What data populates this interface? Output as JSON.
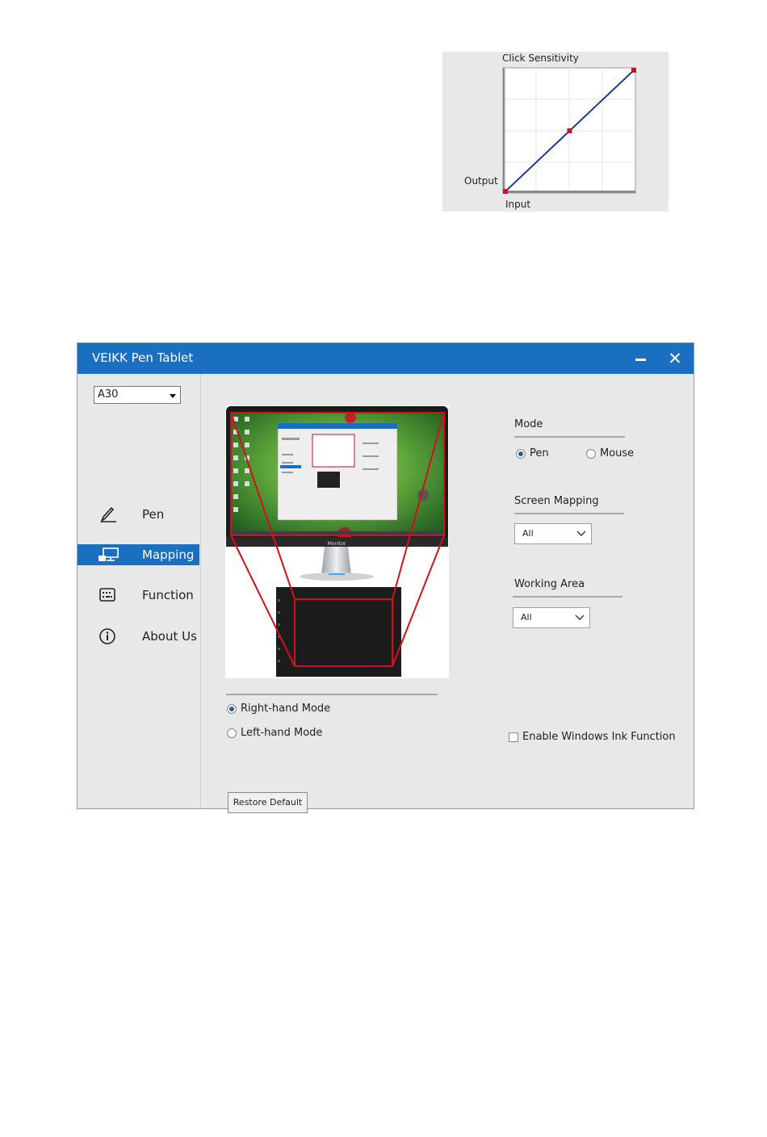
{
  "sensitivity_chart": {
    "title": "Click Sensitivity",
    "y_label": "Output",
    "x_label": "Input",
    "points": [
      [
        0,
        0
      ],
      [
        0.5,
        0.5
      ],
      [
        1,
        1
      ]
    ],
    "line_color": "#1f3a93",
    "point_color": "#c0152f"
  },
  "window": {
    "title": "VEIKK Pen Tablet",
    "minimize_icon": "minimize-icon",
    "close_icon": "close-icon",
    "close_glyph": "✕",
    "accent_color": "#1a6fc1"
  },
  "sidebar": {
    "device": "A30",
    "items": [
      {
        "label": "Pen",
        "icon": "pen-icon",
        "active": false
      },
      {
        "label": "Mapping",
        "icon": "monitor-icon",
        "active": true
      },
      {
        "label": "Function",
        "icon": "keyboard-icon",
        "active": false
      },
      {
        "label": "About Us",
        "icon": "info-icon",
        "active": false
      }
    ]
  },
  "preview": {
    "monitor_label": "Monitor",
    "mapping_frame_color": "#d0121b"
  },
  "hand_mode": {
    "options": [
      {
        "label": "Right-hand Mode",
        "selected": true
      },
      {
        "label": "Left-hand Mode",
        "selected": false
      }
    ]
  },
  "mode": {
    "title": "Mode",
    "options": [
      {
        "label": "Pen",
        "selected": true
      },
      {
        "label": "Mouse",
        "selected": false
      }
    ]
  },
  "screen_mapping": {
    "title": "Screen Mapping",
    "value": "All"
  },
  "working_area": {
    "title": "Working Area",
    "value": "All"
  },
  "windows_ink": {
    "label": "Enable Windows Ink Function",
    "checked": false
  },
  "restore_button": {
    "label": "Restore Default"
  }
}
